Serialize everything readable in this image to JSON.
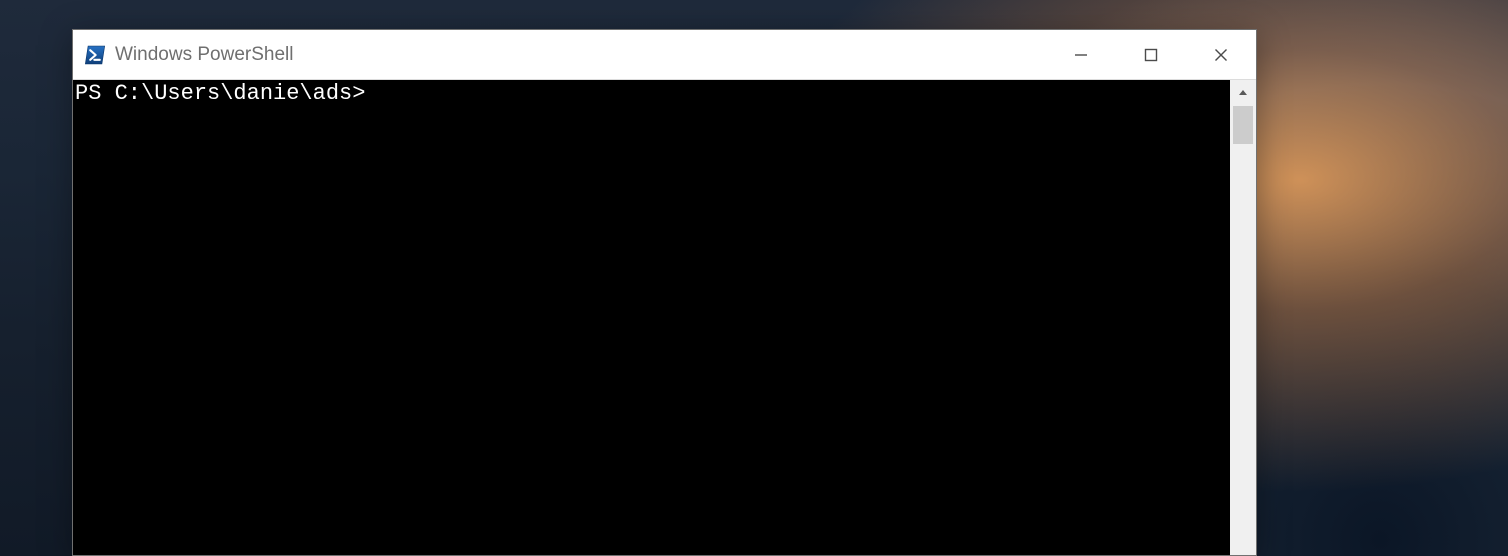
{
  "window": {
    "title": "Windows PowerShell",
    "icon": "powershell-icon"
  },
  "controls": {
    "minimize": "minimize-icon",
    "maximize": "maximize-icon",
    "close": "close-icon",
    "scroll_up": "chevron-up-icon"
  },
  "terminal": {
    "prompt": "PS C:\\Users\\danie\\ads>",
    "input": ""
  },
  "colors": {
    "terminal_bg": "#000000",
    "terminal_fg": "#ffffff",
    "titlebar_bg": "#ffffff",
    "title_fg": "#6f6f6f"
  }
}
